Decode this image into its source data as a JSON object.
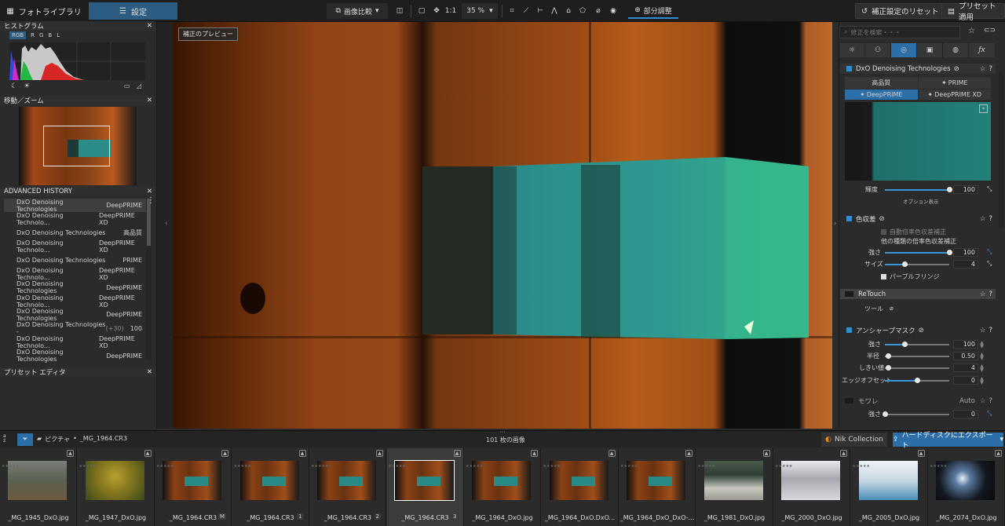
{
  "topbar": {
    "tab_library": "フォトライブラリ",
    "tab_customize": "設定",
    "compare_label": "画像比較",
    "zoom_1to1": "1:1",
    "zoom_value": "35 %",
    "local_adjust": "部分調整",
    "reset_label": "補正設定のリセット",
    "preset_apply": "プリセット適用"
  },
  "left": {
    "histogram_title": "ヒストグラム",
    "channels": [
      "RGB",
      "R",
      "G",
      "B",
      "L"
    ],
    "navigator_title": "移動／ズーム",
    "history_title": "ADVANCED HISTORY",
    "history": [
      {
        "name": "DxO Denoising Technologies",
        "value": "DeepPRIME",
        "extra": ""
      },
      {
        "name": "DxO Denoising Technolo...",
        "value": "DeepPRIME XD",
        "extra": ""
      },
      {
        "name": "DxO Denoising Technologies",
        "value": "高品質",
        "extra": ""
      },
      {
        "name": "DxO Denoising Technolo...",
        "value": "DeepPRIME XD",
        "extra": ""
      },
      {
        "name": "DxO Denoising Technologies",
        "value": "PRIME",
        "extra": ""
      },
      {
        "name": "DxO Denoising Technolo...",
        "value": "DeepPRIME XD",
        "extra": ""
      },
      {
        "name": "DxO Denoising Technologies",
        "value": "DeepPRIME",
        "extra": ""
      },
      {
        "name": "DxO Denoising Technolo...",
        "value": "DeepPRIME XD",
        "extra": ""
      },
      {
        "name": "DxO Denoising Technologies",
        "value": "DeepPRIME",
        "extra": ""
      },
      {
        "name": "DxO Denoising Technologies -",
        "value": "100",
        "extra": "(+30)"
      },
      {
        "name": "DxO Denoising Technolo...",
        "value": "DeepPRIME XD",
        "extra": ""
      },
      {
        "name": "DxO Denoising Technologies",
        "value": "DeepPRIME",
        "extra": ""
      }
    ],
    "preset_editor_title": "プリセット エディタ"
  },
  "viewer": {
    "preview_label": "補正のプレビュー"
  },
  "right": {
    "search_placeholder": "修正を検索・・・",
    "denoise_title": "DxO Denoising Technologies",
    "mode_hq": "高品質",
    "mode_prime": "PRIME",
    "mode_deepprime": "DeepPRIME",
    "mode_deepprime_xd": "DeepPRIME XD",
    "luminance_label": "輝度",
    "luminance_value": "100",
    "options_label": "オプション表示",
    "ca_title": "色収差",
    "ca_auto_label": "自動倍率色収差補正",
    "ca_other_label": "他の種類の倍率色収差補正",
    "strength_label": "強さ",
    "ca_strength_value": "100",
    "size_label": "サイズ",
    "ca_size_value": "4",
    "purple_fringe_label": "パープルフリンジ",
    "retouch_title": "ReTouch",
    "tool_label": "ツール",
    "unsharp_title": "アンシャープマスク",
    "us_strength_value": "100",
    "radius_label": "半径",
    "us_radius_value": "0.50",
    "threshold_label": "しきい値",
    "us_threshold_value": "4",
    "edge_offset_label": "エッジオフセット",
    "us_edge_value": "0",
    "moire_title": "モワレ",
    "moire_auto": "Auto",
    "moire_strength_value": "0",
    "levels": {
      "luminance": 1.0,
      "ca_strength": 1.0,
      "ca_size": 0.3,
      "us_strength": 0.3,
      "us_radius": 0.05,
      "us_threshold": 0.05,
      "us_edge": 0.5,
      "moire": 0.0
    }
  },
  "bottom": {
    "sort_label": "a z",
    "folder_label": "ピクチャ",
    "file_label": "_MG_1964.CR3",
    "count_label": "101 枚の画像",
    "nik_label": "Nik Collection",
    "export_label": "ハードディスクにエクスポート"
  },
  "thumbnails": [
    {
      "name": "_MG_1945_DxO.jpg",
      "badge": "",
      "kind": "animal"
    },
    {
      "name": "_MG_1947_DxO.jpg",
      "badge": "",
      "kind": "tree"
    },
    {
      "name": "_MG_1964.CR3",
      "badge": "M",
      "kind": "wood"
    },
    {
      "name": "_MG_1964.CR3",
      "badge": "1",
      "kind": "wood"
    },
    {
      "name": "_MG_1964.CR3",
      "badge": "2",
      "kind": "wood"
    },
    {
      "name": "_MG_1964.CR3",
      "badge": "3",
      "kind": "wood",
      "selected": true
    },
    {
      "name": "_MG_1964_DxO.jpg",
      "badge": "",
      "kind": "wood"
    },
    {
      "name": "_MG_1964_DxO.DxO...",
      "badge": "",
      "kind": "wood"
    },
    {
      "name": "_MG_1964_DxO_DxO-...",
      "badge": "",
      "kind": "wood"
    },
    {
      "name": "_MG_1981_DxO.jpg",
      "badge": "",
      "kind": "room"
    },
    {
      "name": "_MG_2000_DxO.jpg",
      "badge": "",
      "kind": "snow"
    },
    {
      "name": "_MG_2005_DxO.jpg",
      "badge": "",
      "kind": "light"
    },
    {
      "name": "_MG_2074_DxO.jpg",
      "badge": "",
      "kind": "dark"
    }
  ],
  "colors": {
    "accent": "#2f8ccf",
    "panel": "#2b2b2b"
  }
}
